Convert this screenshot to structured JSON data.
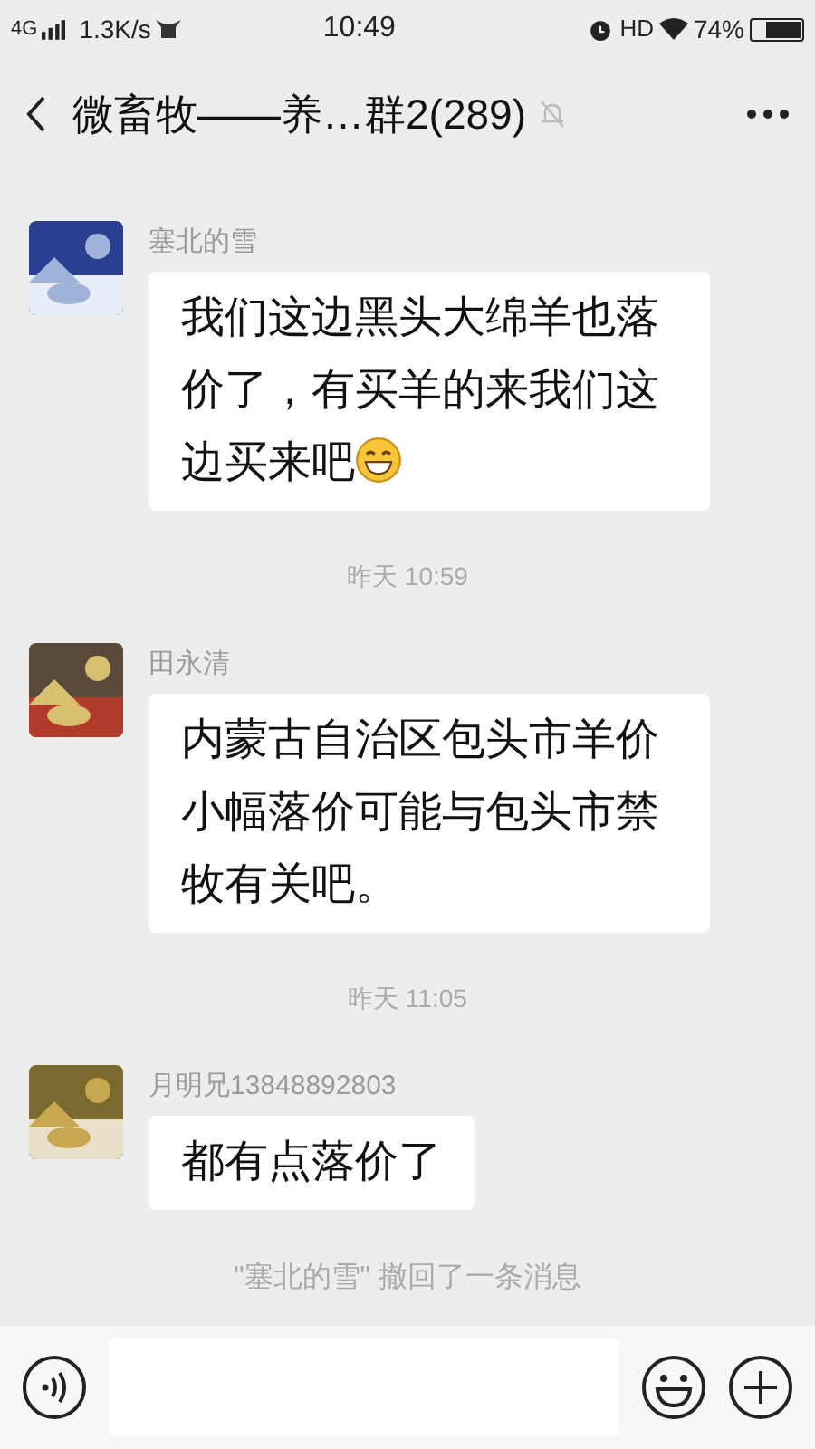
{
  "status_bar": {
    "network": "4G",
    "speed": "1.3K/s",
    "time": "10:49",
    "hd": "HD",
    "battery": "74%"
  },
  "header": {
    "title": "微畜牧——养…群2(289)",
    "muted": true
  },
  "messages": [
    {
      "kind": "message",
      "sender": "塞北的雪",
      "text": "我们这边黑头大绵羊也落价了，有买羊的来我们这边买来吧",
      "emoji": true
    },
    {
      "kind": "time",
      "text": "昨天 10:59"
    },
    {
      "kind": "message",
      "sender": "田永清",
      "text": "内蒙古自治区包头市羊价小幅落价可能与包头市禁牧有关吧。",
      "emoji": false
    },
    {
      "kind": "time",
      "text": "昨天 11:05"
    },
    {
      "kind": "message",
      "sender": "月明兄13848892803",
      "text": "都有点落价了",
      "emoji": false
    },
    {
      "kind": "notice",
      "text": "\"塞北的雪\" 撤回了一条消息"
    }
  ]
}
